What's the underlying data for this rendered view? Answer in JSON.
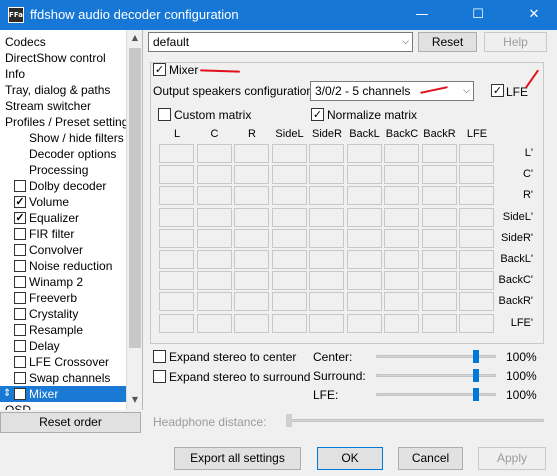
{
  "window": {
    "title": "ffdshow audio decoder configuration",
    "icon_text": "FFa",
    "controls": [
      "—",
      "☐",
      "✕"
    ]
  },
  "sidebar": {
    "items": [
      {
        "label": "Codecs"
      },
      {
        "label": "DirectShow control"
      },
      {
        "label": "Info"
      },
      {
        "label": "Tray, dialog & paths"
      },
      {
        "label": "Stream switcher"
      },
      {
        "label": "Profiles / Preset settings"
      },
      {
        "label": "Show / hide filters"
      },
      {
        "label": "Decoder options"
      },
      {
        "label": "Processing"
      },
      {
        "label": "Dolby decoder",
        "checked": false
      },
      {
        "label": "Volume",
        "checked": true
      },
      {
        "label": "Equalizer",
        "checked": true
      },
      {
        "label": "FIR filter",
        "checked": false
      },
      {
        "label": "Convolver",
        "checked": false
      },
      {
        "label": "Noise reduction",
        "checked": false
      },
      {
        "label": "Winamp 2",
        "checked": false
      },
      {
        "label": "Freeverb",
        "checked": false
      },
      {
        "label": "Crystality",
        "checked": false
      },
      {
        "label": "Resample",
        "checked": false
      },
      {
        "label": "Delay",
        "checked": false
      },
      {
        "label": "LFE Crossover",
        "checked": false
      },
      {
        "label": "Swap channels",
        "checked": false
      },
      {
        "label": "Mixer",
        "checked": true,
        "selected": true
      },
      {
        "label": "OSD"
      }
    ],
    "reset_order_label": "Reset order"
  },
  "preset": {
    "value": "default",
    "reset_label": "Reset",
    "help_label": "Help"
  },
  "mixer": {
    "enabled_label": "Mixer",
    "enabled": true,
    "output_config_label": "Output speakers configuration:",
    "output_config_value": "3/0/2 - 5 channels",
    "lfe_label": "LFE",
    "lfe_checked": true,
    "custom_matrix_label": "Custom matrix",
    "custom_matrix_checked": false,
    "normalize_matrix_label": "Normalize matrix",
    "normalize_matrix_checked": true,
    "columns": [
      "L",
      "C",
      "R",
      "SideL",
      "SideR",
      "BackL",
      "BackC",
      "BackR",
      "LFE"
    ],
    "rows": [
      "L'",
      "C'",
      "R'",
      "SideL'",
      "SideR'",
      "BackL'",
      "BackC'",
      "BackR'",
      "LFE'"
    ],
    "expand_center_label": "Expand stereo to center",
    "expand_center_checked": false,
    "expand_surround_label": "Expand stereo to surround",
    "expand_surround_checked": false,
    "sliders": [
      {
        "label": "Center:",
        "value_text": "100%",
        "level": 0.5
      },
      {
        "label": "Surround:",
        "value_text": "100%",
        "level": 0.5
      },
      {
        "label": "LFE:",
        "value_text": "100%",
        "level": 0.5
      }
    ],
    "headphone_label": "Headphone distance:"
  },
  "footer": {
    "export_label": "Export all settings",
    "ok_label": "OK",
    "cancel_label": "Cancel",
    "apply_label": "Apply"
  },
  "colors": {
    "titlebar": "#1677d6",
    "selection": "#1979d4",
    "annotation": "#e0111a"
  }
}
